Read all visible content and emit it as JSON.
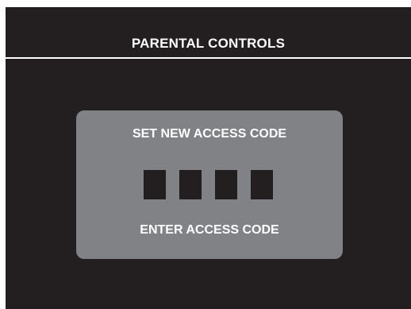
{
  "header": {
    "title": "PARENTAL CONTROLS"
  },
  "dialog": {
    "heading": "SET NEW ACCESS CODE",
    "prompt": "ENTER ACCESS CODE",
    "code_slots": [
      "",
      "",
      "",
      ""
    ]
  },
  "colors": {
    "background": "#231f20",
    "dialog": "#818285",
    "text": "#ffffff",
    "code_box": "#231f20"
  }
}
